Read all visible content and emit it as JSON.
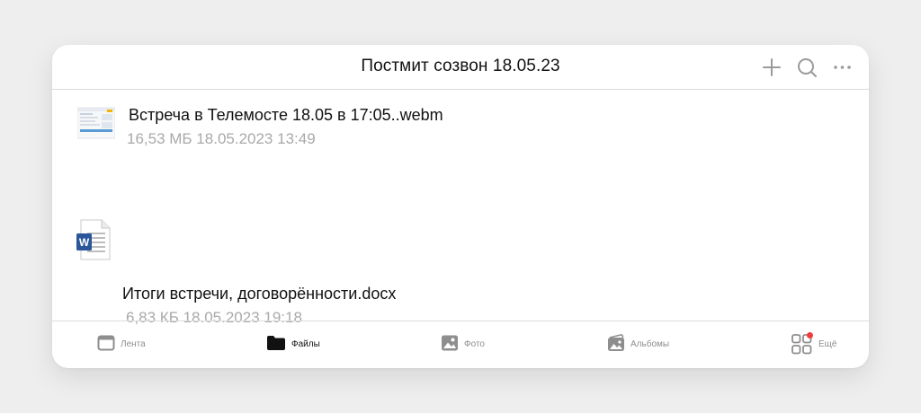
{
  "header": {
    "title": "Постмит созвон 18.05.23",
    "icons": [
      "plus-icon",
      "search-icon",
      "more-icon"
    ]
  },
  "files": [
    {
      "name": "Встреча в Телемосте 18.05 в 17:05..webm",
      "size": "16,53 МБ",
      "date": "18.05.2023 13:49",
      "meta": "16,53 МБ 18.05.2023 13:49",
      "icon": "video-thumbnail"
    },
    {
      "name": "Итоги встречи, договорённости.docx",
      "size": "6,83 КБ",
      "date": "18.05.2023 19:18",
      "meta": "6,83 КБ 18.05.2023 19:18",
      "icon": "word-doc-icon"
    }
  ],
  "tabs": [
    {
      "label": "Лента",
      "icon": "feed-icon",
      "active": false
    },
    {
      "label": "Файлы",
      "icon": "folder-icon",
      "active": true
    },
    {
      "label": "Фото",
      "icon": "photo-icon",
      "active": false
    },
    {
      "label": "Альбомы",
      "icon": "albums-icon",
      "active": false
    },
    {
      "label": "Ещё",
      "icon": "more-apps-icon",
      "active": false,
      "badge": true
    }
  ],
  "colors": {
    "accent_badge": "#f23b3b",
    "word_blue": "#2b579a",
    "icon_gray": "#8e8e8e",
    "active": "#111111",
    "meta_text": "#a9a9a9"
  }
}
